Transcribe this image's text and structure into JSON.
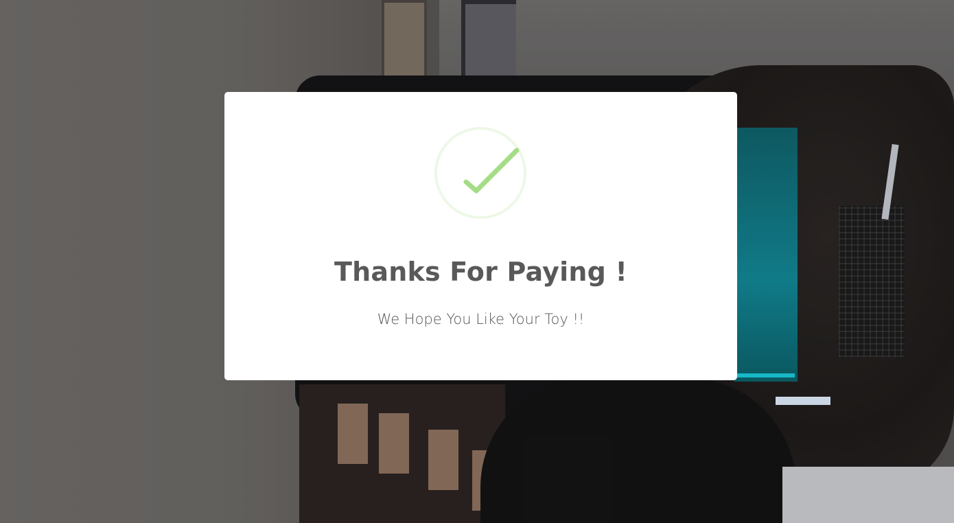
{
  "modal": {
    "icon": "success-check-icon",
    "title": "Thanks For Paying !",
    "text": "We Hope You Like Your Toy !!"
  },
  "colors": {
    "success_green": "#a5dc86",
    "success_ring": "rgba(165,220,134,0.2)",
    "title_text": "#595959",
    "body_text": "#545454",
    "modal_background": "#ffffff"
  }
}
